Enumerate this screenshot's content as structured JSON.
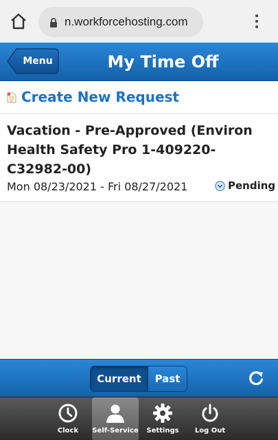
{
  "browser": {
    "url": "n.workforcehosting.com"
  },
  "header": {
    "menu_label": "Menu",
    "title": "My Time Off"
  },
  "main": {
    "create_label": "Create New Request",
    "requests": [
      {
        "title": "Vacation - Pre-Approved (Environ Health Safety Pro 1-409220-C32982-00)",
        "dates": "Mon 08/23/2021 - Fri 08/27/2021",
        "status": "Pending"
      }
    ]
  },
  "toolbar": {
    "tabs": [
      {
        "label": "Current",
        "active": true
      },
      {
        "label": "Past",
        "active": false
      }
    ]
  },
  "nav": {
    "items": [
      {
        "label": "Clock",
        "icon": "clock-icon"
      },
      {
        "label": "Self-Service",
        "icon": "person-icon",
        "active": true
      },
      {
        "label": "Settings",
        "icon": "gear-icon"
      },
      {
        "label": "Log Out",
        "icon": "power-icon"
      }
    ]
  },
  "colors": {
    "header_blue": "#1f74c3",
    "link_blue": "#1a73c8",
    "nav_dark": "#3a3a3a"
  }
}
